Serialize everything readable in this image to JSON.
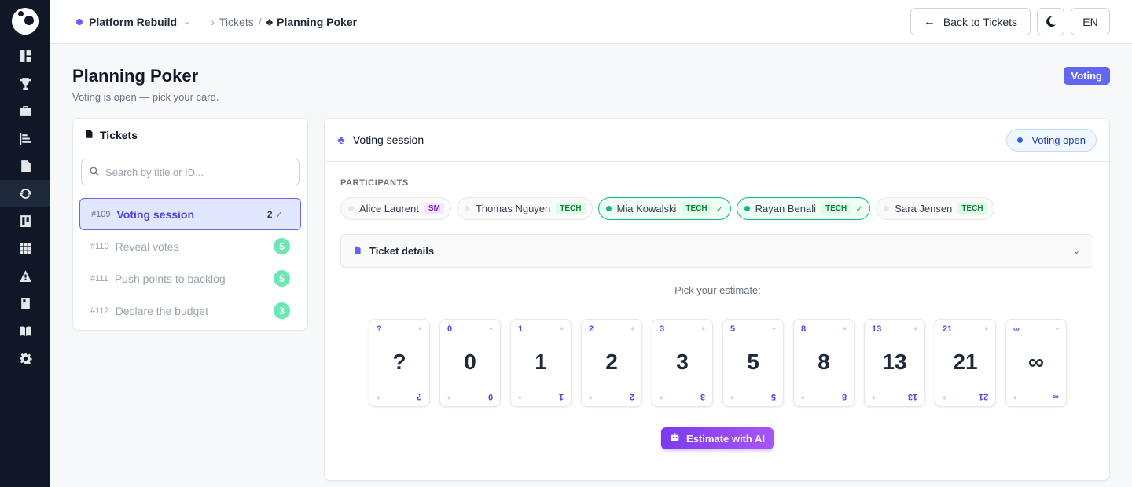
{
  "header": {
    "project": "Platform Rebuild",
    "breadcrumb_parent": "Tickets",
    "breadcrumb_current": "Planning Poker",
    "back_label": "Back to Tickets",
    "lang": "EN"
  },
  "page": {
    "title": "Planning Poker",
    "subtitle": "Voting is open — pick your card.",
    "status": "Voting"
  },
  "tickets_panel": {
    "title": "Tickets",
    "search_placeholder": "Search by title or ID...",
    "items": [
      {
        "id": "#109",
        "name": "Voting session",
        "count": "2",
        "active": true
      },
      {
        "id": "#110",
        "name": "Reveal votes",
        "points": "5"
      },
      {
        "id": "#111",
        "name": "Push points to backlog",
        "points": "5"
      },
      {
        "id": "#112",
        "name": "Declare the budget",
        "points": "3"
      }
    ]
  },
  "voting": {
    "title": "Voting session",
    "state": "Voting open",
    "participants_label": "PARTICIPANTS",
    "participants": [
      {
        "name": "Alice Laurent",
        "role": "SM",
        "voted": false
      },
      {
        "name": "Thomas Nguyen",
        "role": "TECH",
        "voted": false
      },
      {
        "name": "Mia Kowalski",
        "role": "TECH",
        "voted": true
      },
      {
        "name": "Rayan Benali",
        "role": "TECH",
        "voted": true
      },
      {
        "name": "Sara Jensen",
        "role": "TECH",
        "voted": false
      }
    ],
    "details_label": "Ticket details",
    "pick_label": "Pick your estimate:",
    "cards": [
      "?",
      "0",
      "1",
      "2",
      "3",
      "5",
      "8",
      "13",
      "21",
      "∞"
    ],
    "ai_label": "Estimate with AI"
  },
  "colors": {
    "accent": "#6366f1",
    "sidebar": "#101828",
    "success": "#10b981"
  }
}
